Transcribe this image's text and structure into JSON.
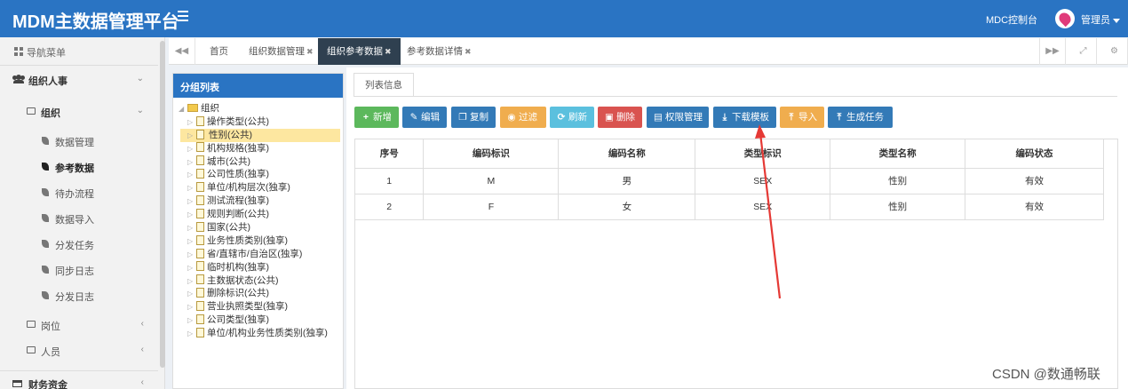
{
  "header": {
    "brand": "MDM主数据管理平台",
    "mdc_link": "MDC控制台",
    "admin_label": "管理员"
  },
  "sidebar": {
    "nav_title": "导航菜单",
    "group_org_people": "组织人事",
    "sub_org": "组织",
    "org_items": [
      "数据管理",
      "参考数据",
      "待办流程",
      "数据导入",
      "分发任务",
      "同步日志",
      "分发日志"
    ],
    "active_item": "参考数据",
    "sub_position": "岗位",
    "sub_person": "人员",
    "group_finance": "财务资金"
  },
  "tabs": [
    {
      "label": "首页",
      "closable": false
    },
    {
      "label": "组织数据管理",
      "closable": true
    },
    {
      "label": "组织参考数据",
      "closable": true,
      "active": true
    },
    {
      "label": "参考数据详情",
      "closable": true
    }
  ],
  "left_panel": {
    "title": "分组列表",
    "root": "组织",
    "nodes": [
      "操作类型(公共)",
      "性别(公共)",
      "机构规格(独享)",
      "城市(公共)",
      "公司性质(独享)",
      "单位/机构层次(独享)",
      "测试流程(独享)",
      "规则判断(公共)",
      "国家(公共)",
      "业务性质类别(独享)",
      "省/直辖市/自治区(独享)",
      "临时机构(独享)",
      "主数据状态(公共)",
      "删除标识(公共)",
      "营业执照类型(独享)",
      "公司类型(独享)",
      "单位/机构业务性质类别(独享)"
    ],
    "selected": "性别(公共)"
  },
  "right_panel": {
    "subtab": "列表信息",
    "buttons": [
      {
        "label": "新增",
        "icon": "plus-icon",
        "color": "#5cb85c"
      },
      {
        "label": "编辑",
        "icon": "edit-icon",
        "color": "#337ab7"
      },
      {
        "label": "复制",
        "icon": "copy-icon",
        "color": "#337ab7"
      },
      {
        "label": "过滤",
        "icon": "eye-icon",
        "color": "#f0ad4e"
      },
      {
        "label": "刷新",
        "icon": "refresh-icon",
        "color": "#5bc0de"
      },
      {
        "label": "删除",
        "icon": "trash-icon",
        "color": "#d9534f"
      },
      {
        "label": "权限管理",
        "icon": "briefcase-icon",
        "color": "#337ab7"
      },
      {
        "label": "下载模板",
        "icon": "download-icon",
        "color": "#337ab7"
      },
      {
        "label": "导入",
        "icon": "upload-icon",
        "color": "#f0ad4e"
      },
      {
        "label": "生成任务",
        "icon": "upload-icon",
        "color": "#337ab7"
      }
    ],
    "table": {
      "columns": [
        "序号",
        "编码标识",
        "编码名称",
        "类型标识",
        "类型名称",
        "编码状态"
      ],
      "rows": [
        [
          "1",
          "M",
          "男",
          "SEX",
          "性别",
          "有效"
        ],
        [
          "2",
          "F",
          "女",
          "SEX",
          "性别",
          "有效"
        ]
      ]
    }
  },
  "watermark": "CSDN @数通畅联"
}
